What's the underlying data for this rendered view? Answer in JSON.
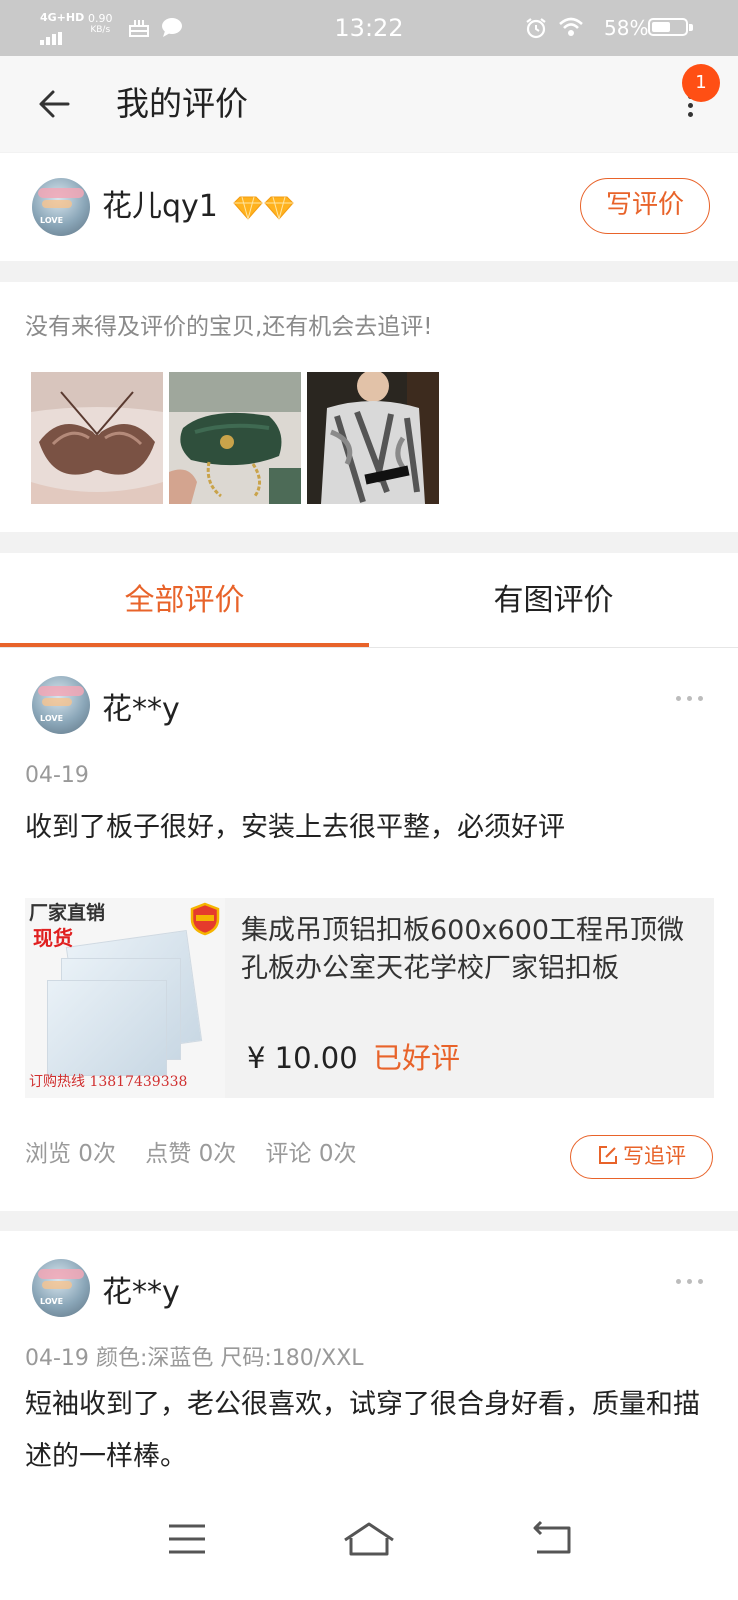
{
  "status_bar": {
    "network": "4G+HD",
    "speed_value": "0.90",
    "speed_unit": "KB/s",
    "time": "13:22",
    "battery": "58%",
    "battery_level": 0.58
  },
  "header": {
    "title": "我的评价",
    "notification_count": "1"
  },
  "user": {
    "name": "花儿qy1",
    "write_review_label": "写评价"
  },
  "pending": {
    "prompt": "没有来得及评价的宝贝,还有机会去追评!",
    "thumbnails": [
      "lace-bra-thumbnail",
      "green-handbag-thumbnail",
      "printed-tshirt-thumbnail"
    ]
  },
  "tabs": [
    {
      "label": "全部评价",
      "active": true
    },
    {
      "label": "有图评价",
      "active": false
    }
  ],
  "reviews": [
    {
      "reviewer": "花**y",
      "date": "04-19",
      "text": "收到了板子很好，安装上去很平整，必须好评",
      "product": {
        "image_badge_1": "厂家直销",
        "image_badge_2": "现货",
        "image_hotline": "订购热线 13817439338",
        "title": "集成吊顶铝扣板600x600工程吊顶微孔板办公室天花学校厂家铝扣板",
        "price": "¥ 10.00",
        "status": "已好评"
      },
      "stats": {
        "views": "浏览 0次",
        "likes": "点赞 0次",
        "comments": "评论 0次"
      },
      "followup_label": "写追评"
    },
    {
      "reviewer": "花**y",
      "date": "04-19",
      "sku": "颜色:深蓝色 尺码:180/XXL",
      "text": "短袖收到了，老公很喜欢，试穿了很合身好看，质量和描述的一样棒。"
    }
  ],
  "colors": {
    "accent": "#e8632a",
    "badge": "#ff4f14",
    "status_bar_bg": "#c9c9c9",
    "page_bg": "#f2f2f2"
  }
}
